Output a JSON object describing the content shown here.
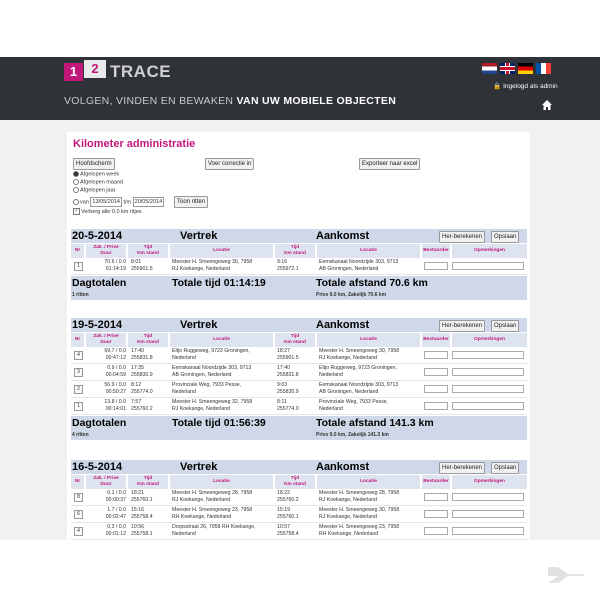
{
  "header": {
    "logo_1": "1",
    "logo_2": "2",
    "logo_text": "TRACE",
    "tagline_light": "VOLGEN, VINDEN EN BEWAKEN",
    "tagline_bold": "VAN UW MOBIELE OBJECTEN",
    "login_text": "Ingelogd als admin",
    "flags": [
      "nl-flag-icon",
      "uk-flag-icon",
      "de-flag-icon",
      "fr-flag-icon"
    ],
    "colors": {
      "bar": "#2f3338",
      "accent": "#c2177a"
    }
  },
  "page": {
    "title": "Kilometer administratie",
    "buttons": {
      "hoofdscherm": "Hoofdscherm",
      "correctie": "Voer correctie in",
      "export": "Exporteer naar excel",
      "toon": "Toon ritten"
    },
    "periods": [
      "Afgelopen week",
      "Afgelopen maand",
      "Afgelopen jaar"
    ],
    "range_van": "van",
    "range_from": "13/05/2014",
    "range_tm": "t/m",
    "range_to": "20/05/2014",
    "hide_zero": "Verberg alle 0.0 km ritjes"
  },
  "labels": {
    "vertrek": "Vertrek",
    "aankomst": "Aankomst",
    "herberekenen": "Her-berekenen",
    "opslaan": "Opslaan",
    "nr": "Nr",
    "zak_prive": "Zak. / Prive",
    "duur": "Duur",
    "tijd": "Tijd",
    "km_stand": "Km stand",
    "locatie": "Locatie",
    "bestuurder": "Bestuurder",
    "opmerkingen": "Opmerkingen",
    "dagtotalen": "Dagtotalen"
  },
  "days": [
    {
      "date": "20-5-2014",
      "rows": [
        {
          "nr": "1",
          "km": "70.6 / 0.0",
          "dur": "01:14:19",
          "vt": "8:01",
          "vk": "255901.5",
          "vl1": "Meester H. Smeengeweg 30, 7958",
          "vl2": "RJ Koekange, Nederland",
          "at": "9:16",
          "ak": "255972.1",
          "al1": "Eemskanaal Noordzijde 303, 9713",
          "al2": "AB Groningen, Nederland"
        }
      ],
      "total_time": "Totale tijd 01:14:19",
      "total_dist": "Totale afstand 70.6 km",
      "ritten": "1 ritten",
      "prive": "Prive 0.0 km, Zakelijk 70.6 km"
    },
    {
      "date": "19-5-2014",
      "rows": [
        {
          "nr": "4",
          "km": "69.7 / 0.0",
          "dur": "00:47:12",
          "vt": "17:40",
          "vk": "255831.8",
          "vl1": "Eltjo Ruggeweg, 9723 Groningen,",
          "vl2": "Nederland",
          "at": "18:27",
          "ak": "255901.5",
          "al1": "Meester H. Smeengeweg 30, 7958",
          "al2": "RJ Koekange, Nederland"
        },
        {
          "nr": "3",
          "km": "0.9 / 0.0",
          "dur": "00:04:59",
          "vt": "17:35",
          "vk": "255830.9",
          "vl1": "Eemskanaal Noordzijde 303, 9713",
          "vl2": "AB Groningen, Nederland",
          "at": "17:40",
          "ak": "255831.8",
          "al1": "Eltjo Ruggeweg, 9723 Groningen,",
          "al2": "Nederland"
        },
        {
          "nr": "2",
          "km": "56.9 / 0.0",
          "dur": "00:50:27",
          "vt": "8:12",
          "vk": "255774.0",
          "vl1": "Provinciale Weg, 7933 Pesse,",
          "vl2": "Nederland",
          "at": "9:03",
          "ak": "255830.9",
          "al1": "Eemskanaal Noordzijde 303, 9713",
          "al2": "AB Groningen, Nederland"
        },
        {
          "nr": "1",
          "km": "13.8 / 0.0",
          "dur": "00:14:01",
          "vt": "7:57",
          "vk": "255760.2",
          "vl1": "Meester H. Smeengeweg 32, 7958",
          "vl2": "RJ Koekange, Nederland",
          "at": "8:11",
          "ak": "255774.0",
          "al1": "Provinciale Weg, 7933 Pesse,",
          "al2": "Nederland"
        }
      ],
      "total_time": "Totale tijd 01:56:39",
      "total_dist": "Totale afstand 141.3 km",
      "ritten": "4 ritten",
      "prive": "Prive 0.0 km, Zakelijk 141.3 km"
    },
    {
      "date": "16-5-2014",
      "rows": [
        {
          "nr": "8",
          "km": "0.1 / 0.0",
          "dur": "00:00:37",
          "vt": "18:21",
          "vk": "255760.1",
          "vl1": "Meester H. Smeengeweg 28, 7958",
          "vl2": "RJ Koekange, Nederland",
          "at": "18:22",
          "ak": "255760.2",
          "al1": "Meester H. Smeengeweg 28, 7958",
          "al2": "RJ Koekange, Nederland"
        },
        {
          "nr": "6",
          "km": "1.7 / 0.0",
          "dur": "00:02:47",
          "vt": "15:16",
          "vk": "255758.4",
          "vl1": "Meester H. Smeengeweg 23, 7958",
          "vl2": "RH Koekange, Nederland",
          "at": "15:19",
          "ak": "255760.1",
          "al1": "Meester H. Smeengeweg 30, 7958",
          "al2": "RJ Koekange, Nederland"
        },
        {
          "nr": "4",
          "km": "0.3 / 0.0",
          "dur": "00:01:12",
          "vt": "10:56",
          "vk": "255758.1",
          "vl1": "Dorpsstraat 26, 7958 RH Koekange,",
          "vl2": "Nederland",
          "at": "10:57",
          "ak": "255758.4",
          "al1": "Meester H. Smeengeweg 23, 7958",
          "al2": "RH Koekange, Nederland"
        }
      ]
    }
  ]
}
